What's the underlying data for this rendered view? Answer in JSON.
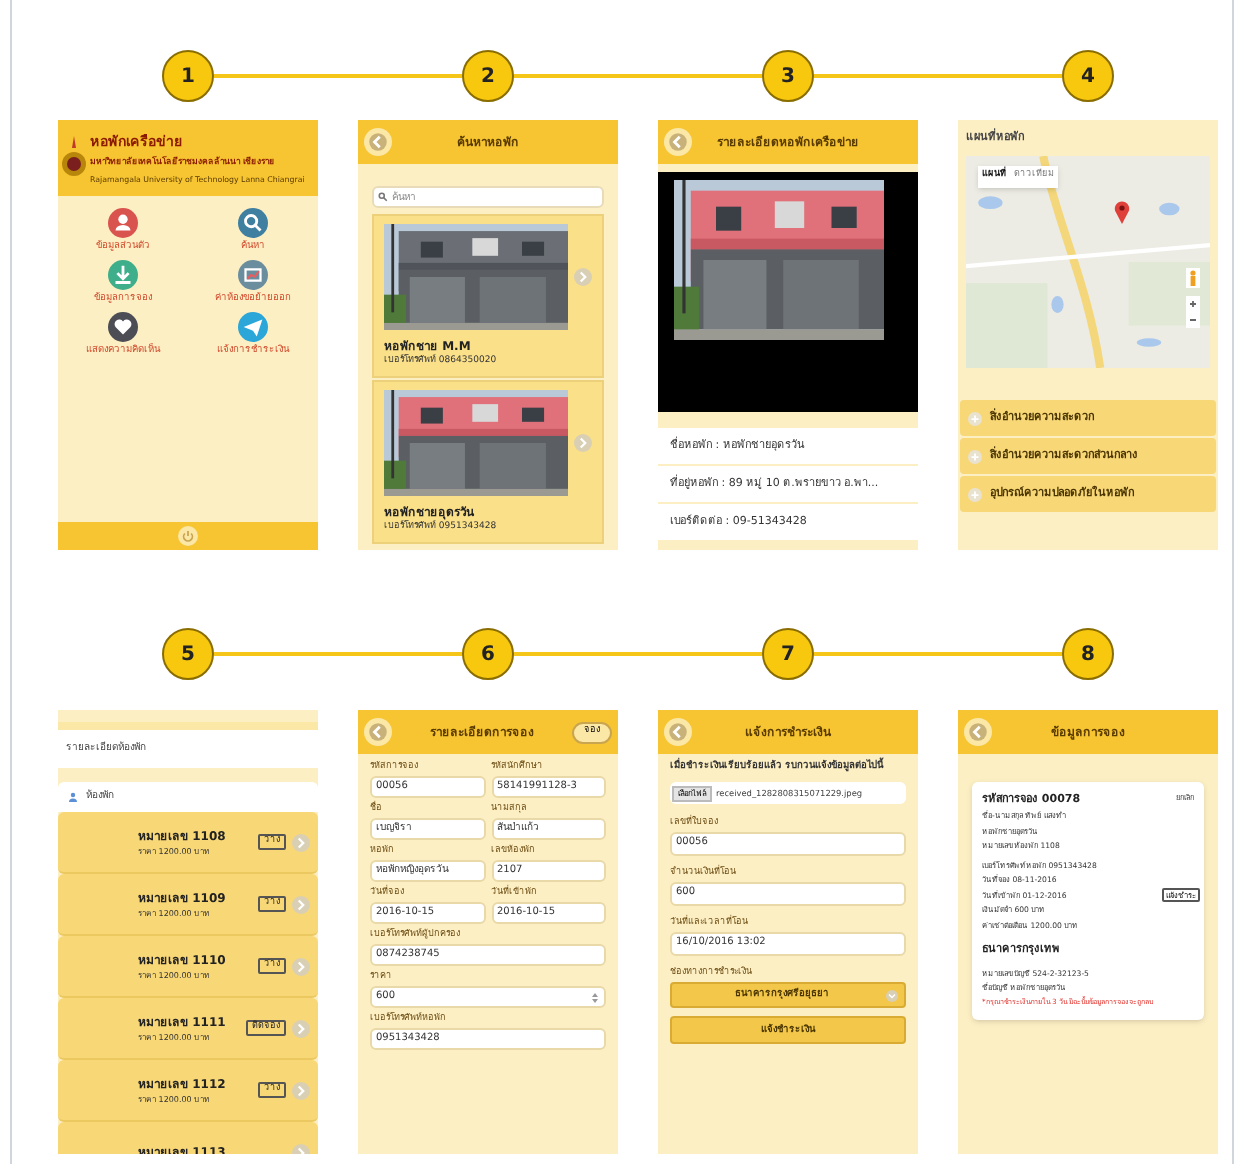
{
  "screens": [
    {
      "number": "1",
      "kind": "home",
      "title": "หอพักเครือข่าย",
      "subtitle": "มหาวิทยาลัยเทคโนโลยีราชมงคลล้านนา เชียงราย",
      "subtitle_en": "Rajamangala University of Technology Lanna Chiangrai",
      "menu": [
        "ข้อมูลส่วนตัว",
        "ค้นหา",
        "ข้อมูลการจอง",
        "ค่าห้องขอย้ายออก",
        "แสดงความคิดเห็น",
        "แจ้งการชำระเงิน"
      ]
    },
    {
      "number": "2",
      "kind": "search",
      "title": "ค้นหาหอพัก",
      "search": {
        "placeholder": "ค้นหา"
      },
      "dorms": [
        {
          "name": "หอพักชาย M.M",
          "phone": "เบอร์โทรศัพท์ 0864350020"
        },
        {
          "name": "หอพักชายอุดรวัน",
          "phone": "เบอร์โทรศัพท์ 0951343428"
        }
      ]
    },
    {
      "number": "3",
      "kind": "detail",
      "title": "รายละเอียดหอพักเครือข่าย",
      "details": [
        "ชื่อหอพัก : หอพักชายอุดรวัน",
        "ที่อยู่หอพัก : 89 หมู่ 10 ต.พรายขาว อ.พา...",
        "เบอร์ติดต่อ : 09-51343428"
      ]
    },
    {
      "number": "4",
      "kind": "map",
      "title": "แผนที่หอพัก",
      "map_types": [
        {
          "label": "แผนที่",
          "selected": true
        },
        {
          "label": "ดาวเทียม",
          "selected": false
        }
      ],
      "sections": [
        {
          "label": "สิ่งอำนวยความสะดวก",
          "expanded": false
        },
        {
          "label": "สิ่งอำนวยความสะดวกส่วนกลาง",
          "expanded": false
        },
        {
          "label": "อุปกรณ์ความปลอดภัยในหอพัก",
          "expanded": false
        }
      ]
    },
    {
      "number": "5",
      "kind": "rooms",
      "title": "รายละเอียดห้องพัก",
      "group": "ห้องพัก",
      "rooms": [
        {
          "name": "หมายเลข 1108",
          "price": "ราคา 1200.00 บาท",
          "status": "ว่าง"
        },
        {
          "name": "หมายเลข 1109",
          "price": "ราคา 1200.00 บาท",
          "status": "ว่าง"
        },
        {
          "name": "หมายเลข 1110",
          "price": "ราคา 1200.00 บาท",
          "status": "ว่าง"
        },
        {
          "name": "หมายเลข 1111",
          "price": "ราคา 1200.00 บาท",
          "status": "ติดจอง"
        },
        {
          "name": "หมายเลข 1112",
          "price": "ราคา 1200.00 บาท",
          "status": "ว่าง"
        },
        {
          "name": "หมายเลข 1113"
        }
      ]
    },
    {
      "number": "6",
      "kind": "booking_form",
      "title": "รายละเอียดการจอง",
      "action": "จอง",
      "rows": [
        [
          {
            "label": "รหัสการจอง",
            "value": "00056",
            "kind": "text"
          },
          {
            "label": "รหัสนักศึกษา",
            "value": "58141991128-3",
            "kind": "text"
          }
        ],
        [
          {
            "label": "ชื่อ",
            "value": "เบญจิรา",
            "kind": "text"
          },
          {
            "label": "นามสกุล",
            "value": "สันป่าแก้ว",
            "kind": "text"
          }
        ],
        [
          {
            "label": "หอพัก",
            "value": "หอพักหญิงอุดรวัน",
            "kind": "text"
          },
          {
            "label": "เลขห้องพัก",
            "value": "2107",
            "kind": "text"
          }
        ],
        [
          {
            "label": "วันที่จอง",
            "value": "2016-10-15",
            "kind": "text"
          },
          {
            "label": "วันที่เข้าพัก",
            "value": "2016-10-15",
            "kind": "text"
          }
        ],
        [
          {
            "label": "เบอร์โทรศัพท์ผู้ปกครอง",
            "value": "0874238745",
            "kind": "text"
          }
        ],
        [
          {
            "label": "ราคา",
            "value": "600",
            "kind": "number"
          }
        ],
        [
          {
            "label": "เบอร์โทรศัพท์หอพัก",
            "value": "0951343428",
            "kind": "text"
          }
        ]
      ]
    },
    {
      "number": "7",
      "kind": "payment",
      "title": "แจ้งการชำระเงิน",
      "note": "เมื่อชำระเงินเรียบร้อยแล้ว รบกวนแจ้งข้อมูลต่อไปนี้",
      "file": {
        "button": "เลือกไฟล์",
        "name": "received_1282808315071229.jpeg"
      },
      "fields": [
        {
          "label": "เลขที่ใบจอง",
          "value": "00056"
        },
        {
          "label": "จำนวนเงินที่โอน",
          "value": "600"
        },
        {
          "label": "วันที่และเวลาที่โอน",
          "value": "16/10/2016 13:02"
        }
      ],
      "channel": {
        "label": "ช่องทางการชำระเงิน",
        "value": "ธนาคารกรุงศรีอยุธยา"
      },
      "submit": "แจ้งชำระเงิน"
    },
    {
      "number": "8",
      "kind": "booking_info",
      "title": "ข้อมูลการจอง",
      "card": {
        "heading": "รหัสการจอง 00078",
        "cancel": "ยกเลิก",
        "lines": [
          "ชื่อ-นามสกุล ทิพย์ แสงทำ",
          "หอพักชายอุดรวัน",
          "หมายเลขห้องพัก 1108",
          "เบอร์โทรศัพท์หอพัก 0951343428",
          "วันที่จอง 08-11-2016",
          "วันที่เข้าพัก 01-12-2016",
          "เงินมัดจำ 600 บาท",
          "ค่าเช่าต่อเดือน 1200.00 บาท"
        ],
        "pay_button": "แจ้งชำระ",
        "bank": "ธนาคารกรุงเทพ",
        "bank_lines": [
          "หมายเลขบัญชี 524-2-32123-5",
          "ชื่อบัญชี หอพักชายอุดรวัน"
        ],
        "warning": "*กรุณาชำระเงินภายใน 3 วัน มิฉะนั้นข้อมูลการจองจะถูกลบ"
      }
    }
  ]
}
